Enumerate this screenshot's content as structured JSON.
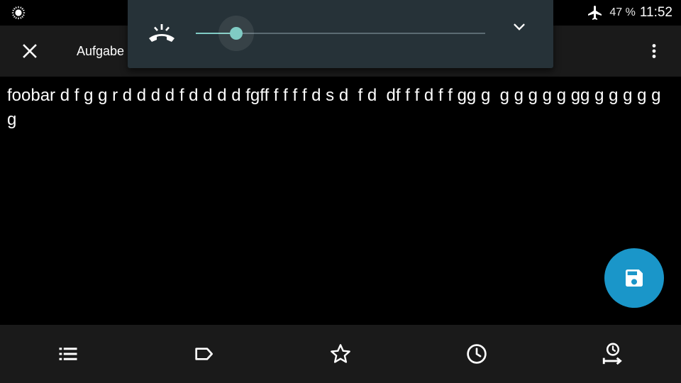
{
  "status_bar": {
    "battery_text": "47 %",
    "time": "11:52"
  },
  "toolbar": {
    "title": "Aufgabe"
  },
  "note": {
    "text": "foobar d f g g r d d d d f d d d d fgff f f f f d s d  f d  df f f d f f gg g  g g g g g gg g g g g g g"
  },
  "volume_panel": {
    "level_fraction": 0.14,
    "colors": {
      "background": "#263238",
      "accent": "#80cbc4"
    }
  },
  "icons": {
    "status_left": "brightness-icon",
    "airplane": "airplane-mode-icon",
    "close": "close-icon",
    "overflow": "more-vertical-icon",
    "ringer": "ringer-volume-icon",
    "expand": "chevron-down-icon",
    "save": "save-icon",
    "list": "list-icon",
    "label": "label-icon",
    "star": "star-icon",
    "reminder": "clock-icon",
    "time_shift": "time-shift-icon"
  },
  "colors": {
    "fab": "#1a96c9",
    "bars": "#1a1a1a"
  }
}
